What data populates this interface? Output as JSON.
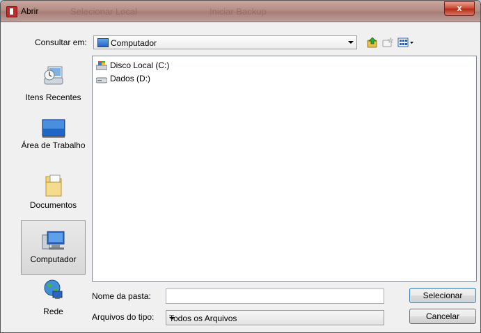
{
  "window": {
    "title": "Abrir",
    "close_symbol": "x",
    "ghost_text_1": "Selecionar Local",
    "ghost_text_2": "Iniciar Backup"
  },
  "toolbar": {
    "look_in_label": "Consultar em:",
    "look_in_value": "Computador"
  },
  "sidebar": {
    "items": [
      {
        "label": "Itens Recentes",
        "icon": "recent-items-icon"
      },
      {
        "label": "Área de Trabalho",
        "icon": "desktop-icon"
      },
      {
        "label": "Documentos",
        "icon": "documents-folder-icon"
      },
      {
        "label": "Computador",
        "icon": "computer-icon",
        "selected": true
      },
      {
        "label": "Rede",
        "icon": "network-globe-icon"
      }
    ]
  },
  "files": [
    {
      "name": "Disco Local (C:)",
      "icon": "local-disk-icon"
    },
    {
      "name": "Dados (D:)",
      "icon": "drive-icon"
    }
  ],
  "footer": {
    "folder_name_label": "Nome da pasta:",
    "folder_name_value": "",
    "file_type_label": "Arquivos do tipo:",
    "file_type_value": "Todos os Arquivos",
    "select_button": "Selecionar",
    "cancel_button": "Cancelar"
  },
  "colors": {
    "titlebar": "#b58d85",
    "close_button": "#c8452f",
    "selection": "#d8d8d8"
  }
}
